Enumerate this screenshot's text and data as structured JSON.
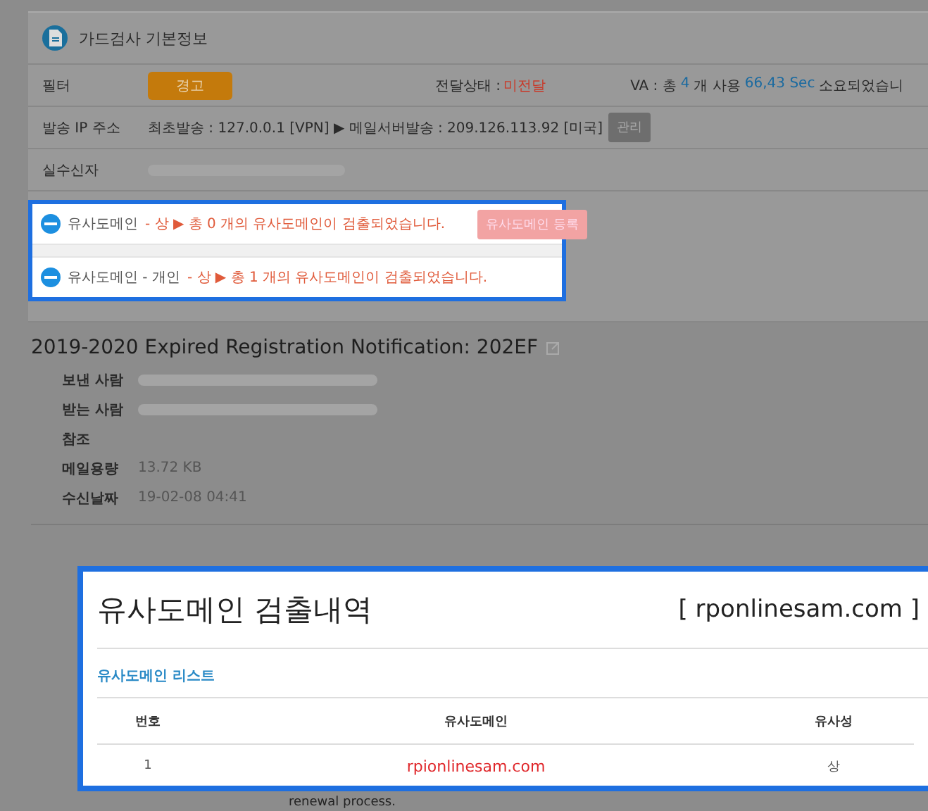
{
  "panel": {
    "title": "가드검사 기본정보",
    "filter_row": {
      "label": "필터",
      "badge": "경고",
      "status_label": "전달상태 :",
      "status_value": "미전달",
      "va": [
        {
          "text": "VA : 총",
          "kind": "plain"
        },
        {
          "text": "4",
          "kind": "value"
        },
        {
          "text": "개 사용",
          "kind": "plain"
        },
        {
          "text": "66,43 Sec",
          "kind": "value"
        },
        {
          "text": "소요되었습니",
          "kind": "plain"
        }
      ]
    },
    "ip_row": {
      "label": "발송 IP 주소",
      "text": "최초발송 : 127.0.0.1 [VPN] ▶ 메일서버발송 : 209.126.113.92 [미국]",
      "button": "관리"
    },
    "recipient_row": {
      "label": "실수신자"
    }
  },
  "alerts": [
    {
      "name": "유사도메인",
      "message": "- 상 ▶ 총 0 개의 유사도메인이 검출되었습니다.",
      "button": "유사도메인 등록"
    },
    {
      "name": "유사도메인 - 개인",
      "message": "- 상 ▶ 총 1 개의 유사도메인이 검출되었습니다."
    }
  ],
  "mail": {
    "subject": "2019-2020 Expired Registration Notification: 202EF",
    "fields": [
      {
        "label": "보낸 사람",
        "redacted": true
      },
      {
        "label": "받는 사람",
        "redacted": true
      },
      {
        "label": "참조",
        "redacted": false
      },
      {
        "label": "메일용량",
        "value": "13.72 KB",
        "redacted": false
      },
      {
        "label": "수신날짜",
        "value": "19-02-08 04:41",
        "redacted": false
      }
    ],
    "body_text": "renewal process."
  },
  "popup": {
    "title": "유사도메인 검출내역",
    "domain": "[ rponlinesam.com ]",
    "list_title": "유사도메인 리스트",
    "columns": [
      "번호",
      "유사도메인",
      "유사성"
    ],
    "rows": [
      [
        "1",
        "rpionlinesam.com",
        "상"
      ]
    ]
  }
}
